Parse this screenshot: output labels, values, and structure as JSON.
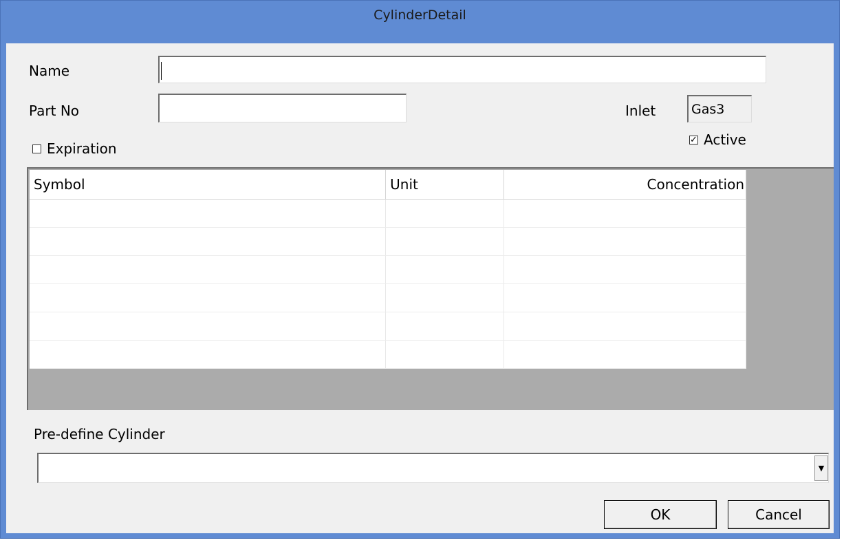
{
  "window": {
    "title": "CylinderDetail"
  },
  "form": {
    "name_label": "Name",
    "name_value": "",
    "partno_label": "Part No",
    "partno_value": "",
    "inlet_label": "Inlet",
    "inlet_value": "Gas3",
    "active": {
      "label": "Active",
      "checked": true,
      "mark": "☑"
    },
    "expiration": {
      "label": "Expiration",
      "checked": false
    }
  },
  "grid": {
    "columns": [
      "Symbol",
      "Unit",
      "Concentration"
    ],
    "rows": [
      [
        "",
        "",
        ""
      ],
      [
        "",
        "",
        ""
      ],
      [
        "",
        "",
        ""
      ],
      [
        "",
        "",
        ""
      ],
      [
        "",
        "",
        ""
      ],
      [
        "",
        "",
        ""
      ]
    ]
  },
  "predefine": {
    "label": "Pre-define Cylinder",
    "value": ""
  },
  "buttons": {
    "ok": "OK",
    "cancel": "Cancel"
  },
  "icons": {
    "dropdown": "chevron-down-icon",
    "check": "checkmark-icon"
  },
  "colors": {
    "titlebar": "#5f8bd3",
    "client": "#f0f0f0",
    "grid_background": "#ababab"
  }
}
